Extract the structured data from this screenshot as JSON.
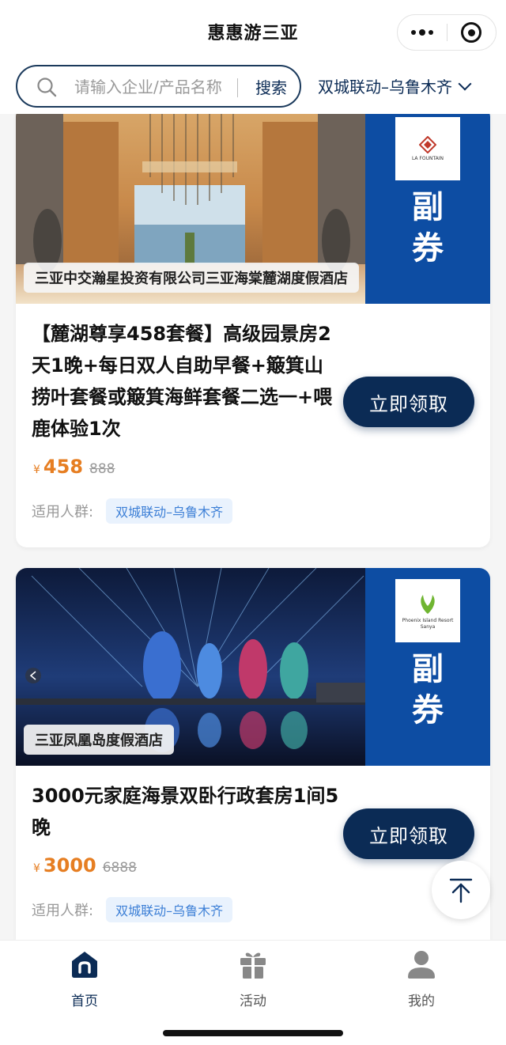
{
  "nav": {
    "title": "惠惠游三亚",
    "more_icon": "more-dots-icon",
    "close_icon": "target-icon"
  },
  "search": {
    "placeholder": "请输入企业/产品名称",
    "button_label": "搜索",
    "city": "双城联动–乌鲁木齐"
  },
  "cards": [
    {
      "hotel_name": "三亚中交瀚星投资有限公司三亚海棠麓湖度假酒店",
      "logo_text": "LA FOUNTAIN",
      "coupon_label_1": "副",
      "coupon_label_2": "券",
      "title": "【麓湖尊享458套餐】高级园景房2天1晚+每日双人自助早餐+簸箕山捞叶套餐或簸箕海鲜套餐二选一+喂鹿体验1次",
      "price_currency": "¥",
      "price_now": "458",
      "price_old": "888",
      "audience_label": "适用人群:",
      "audience_tag": "双城联动–乌鲁木齐",
      "claim_label": "立即领取"
    },
    {
      "hotel_name": "三亚凤凰岛度假酒店",
      "logo_text": "Phoenix Island Resort Sanya",
      "coupon_label_1": "副",
      "coupon_label_2": "券",
      "title": "3000元家庭海景双卧行政套房1间5晚",
      "price_currency": "¥",
      "price_now": "3000",
      "price_old": "6888",
      "audience_label": "适用人群:",
      "audience_tag": "双城联动–乌鲁木齐",
      "claim_label": "立即领取"
    }
  ],
  "tabbar": {
    "tabs": [
      {
        "label": "首页",
        "icon": "home-icon",
        "active": true
      },
      {
        "label": "活动",
        "icon": "gift-icon",
        "active": false
      },
      {
        "label": "我的",
        "icon": "user-icon",
        "active": false
      }
    ]
  },
  "colors": {
    "brand_navy": "#0b2b55",
    "coupon_blue": "#0d4da3",
    "price_orange": "#e67e22"
  }
}
